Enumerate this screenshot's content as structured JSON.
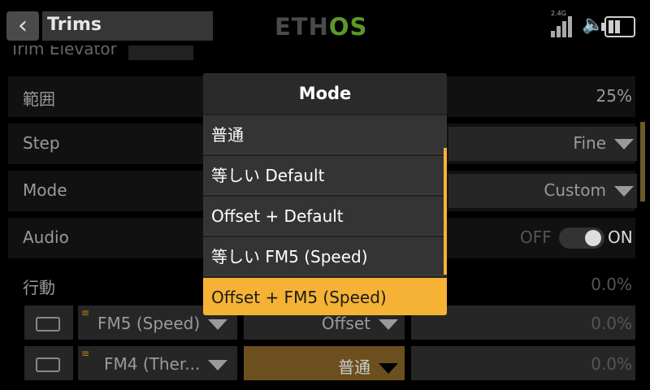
{
  "header": {
    "back_icon": "chevron-left-icon",
    "title": "Trims",
    "logo_left": "ETH",
    "logo_right": "OS",
    "signal_label": "2.4G",
    "colors": {
      "accent": "#f6b234",
      "logo_green": "#5a9a2a"
    }
  },
  "rows": {
    "range": {
      "label": "範囲",
      "value": "25%"
    },
    "step": {
      "label": "Step",
      "value": "Fine"
    },
    "mode": {
      "label": "Mode",
      "value": "Custom"
    },
    "audio": {
      "label": "Audio",
      "off": "OFF",
      "on": "ON"
    },
    "action": {
      "label": "行動",
      "value": "0.0%"
    }
  },
  "sub_rows": [
    {
      "fm": "FM5 (Speed)",
      "mode": "Offset",
      "value": "0.0%"
    },
    {
      "fm": "FM4 (Ther...",
      "mode": "普通",
      "value": "0.0%"
    }
  ],
  "modal": {
    "title": "Mode",
    "options": [
      "普通",
      "等しい Default",
      "Offset + Default",
      "等しい FM5 (Speed)",
      "Offset + FM5 (Speed)"
    ],
    "selected_index": 4
  }
}
